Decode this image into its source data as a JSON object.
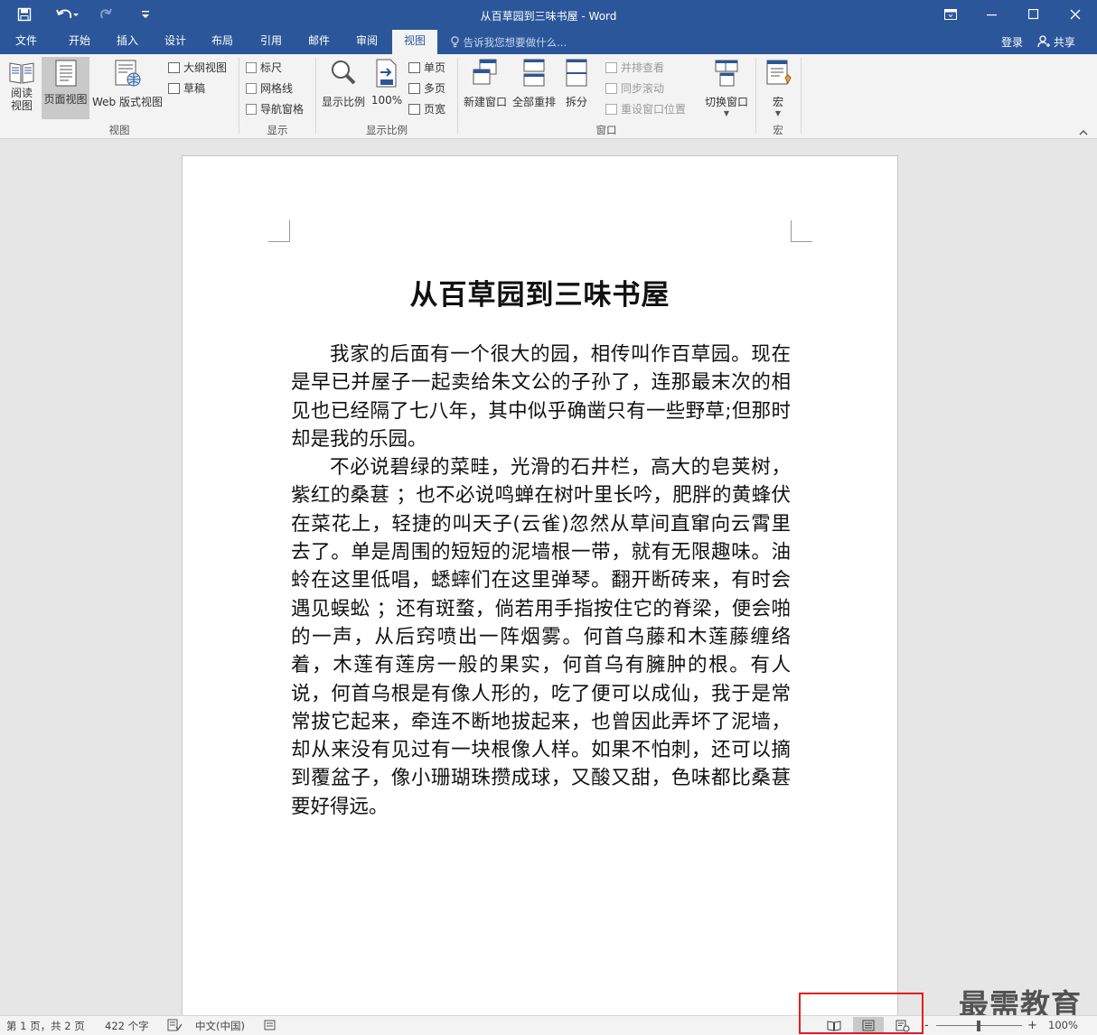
{
  "window": {
    "title": "从百草园到三味书屋 - Word",
    "quick_access": [
      "save-icon",
      "undo-icon",
      "redo-icon",
      "customize-icon"
    ],
    "controls": [
      "ribbon-display-icon",
      "minimize-icon",
      "maximize-icon",
      "close-icon"
    ]
  },
  "tabs": [
    "文件",
    "开始",
    "插入",
    "设计",
    "布局",
    "引用",
    "邮件",
    "审阅",
    "视图"
  ],
  "active_tab": "视图",
  "tellme": "告诉我您想要做什么...",
  "account": {
    "login": "登录",
    "share": "共享"
  },
  "ribbon": {
    "views": {
      "group_label": "视图",
      "read_mode": "阅读\n视图",
      "print_layout": "页面视图",
      "web_layout": "Web 版式视图",
      "outline": "大纲视图",
      "draft": "草稿"
    },
    "show": {
      "group_label": "显示",
      "ruler": "标尺",
      "gridlines": "网格线",
      "nav_pane": "导航窗格"
    },
    "zoom": {
      "group_label": "显示比例",
      "zoom": "显示比例",
      "hundred": "100%",
      "one_page": "单页",
      "multi_page": "多页",
      "page_width": "页宽"
    },
    "window": {
      "group_label": "窗口",
      "new_window": "新建窗口",
      "arrange_all": "全部重排",
      "split": "拆分",
      "side_by_side": "并排查看",
      "sync_scroll": "同步滚动",
      "reset_position": "重设窗口位置",
      "switch_windows": "切换窗口"
    },
    "macros": {
      "group_label": "宏",
      "macros": "宏"
    }
  },
  "document": {
    "title": "从百草园到三味书屋",
    "paragraphs": [
      "我家的后面有一个很大的园，相传叫作百草园。现在是早已并屋子一起卖给朱文公的子孙了，连那最末次的相见也已经隔了七八年，其中似乎确凿只有一些野草;但那时却是我的乐园。",
      "不必说碧绿的菜畦，光滑的石井栏，高大的皂荚树，紫红的桑葚 ；也不必说鸣蝉在树叶里长吟，肥胖的黄蜂伏在菜花上，轻捷的叫天子(云雀)忽然从草间直窜向云霄里去了。单是周围的短短的泥墙根一带，就有无限趣味。油蛉在这里低唱，蟋蟀们在这里弹琴。翻开断砖来，有时会遇见蜈蚣 ；还有斑蝥，倘若用手指按住它的脊梁，便会啪的一声，从后窍喷出一阵烟雾。何首乌藤和木莲藤缠络着，木莲有莲房一般的果实，何首乌有臃肿的根。有人说，何首乌根是有像人形的，吃了便可以成仙，我于是常常拔它起来，牵连不断地拔起来，也曾因此弄坏了泥墙，却从来没有见过有一块根像人样。如果不怕刺，还可以摘到覆盆子，像小珊瑚珠攒成球，又酸又甜，色味都比桑葚要好得远。"
    ]
  },
  "status": {
    "page": "第 1 页，共 2 页",
    "words": "422 个字",
    "language": "中文(中国)",
    "zoom": "100%",
    "zoom_minus": "-",
    "zoom_plus": "+"
  },
  "watermark": "最需教育",
  "colors": {
    "accent": "#2b579a",
    "highlight": "#e02020"
  }
}
